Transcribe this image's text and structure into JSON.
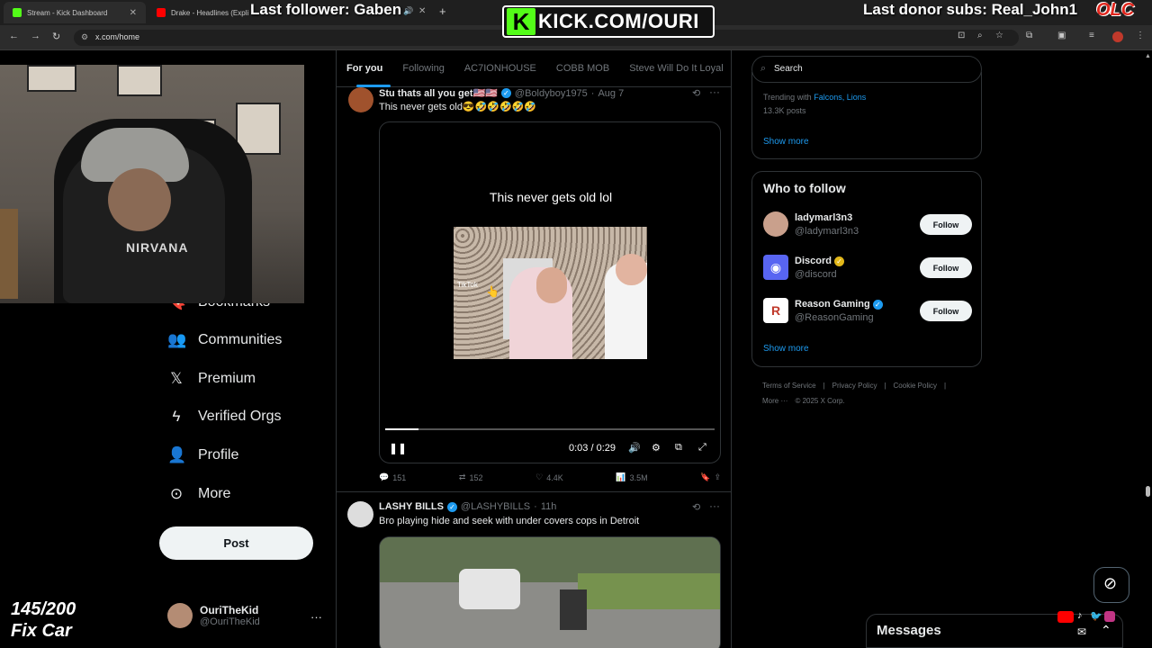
{
  "browser": {
    "tabs": [
      {
        "title": "Stream - Kick Dashboard",
        "favicon_color": "#53fc18"
      },
      {
        "title": "Drake - Headlines (Explicit)",
        "favicon_color": "#ff0000"
      }
    ],
    "url": "x.com/home"
  },
  "overlay": {
    "last_follower": "Last follower: Gaben",
    "kick_url": "KICK.COM/OURI",
    "last_donor": "Last donor subs: Real_John1",
    "brand": "OLC",
    "goal_count": "145/200",
    "goal_name": "Fix Car",
    "shirt_text": "NIRVANA"
  },
  "nav": {
    "items": [
      {
        "label": "Bookmarks",
        "icon": "bookmark-icon"
      },
      {
        "label": "Communities",
        "icon": "communities-icon"
      },
      {
        "label": "Premium",
        "icon": "x-logo-icon"
      },
      {
        "label": "Verified Orgs",
        "icon": "lightning-icon"
      },
      {
        "label": "Profile",
        "icon": "person-icon"
      },
      {
        "label": "More",
        "icon": "more-circle-icon"
      }
    ],
    "post_label": "Post",
    "account": {
      "name": "OuriTheKid",
      "handle": "@OuriTheKid"
    }
  },
  "feed": {
    "tabs": [
      "For you",
      "Following",
      "AC7IONHOUSE",
      "COBB MOB",
      "Steve Will Do It Loyal"
    ],
    "tweets": [
      {
        "name": "Stu thats all you get🇺🇸🇺🇸",
        "handle": "@Boldyboy1975",
        "time": "Aug 7",
        "text": "This never gets old😎🤣🤣🤣🤣🤣",
        "video_caption": "This never gets old lol",
        "video_watermark": "TikTok",
        "video_time": "0:03 / 0:29",
        "video_progress": 0.1,
        "stats": {
          "replies": "151",
          "reposts": "152",
          "likes": "4.4K",
          "views": "3.5M"
        }
      },
      {
        "name": "LASHY BILLS",
        "handle": "@LASHYBILLS",
        "time": "11h",
        "text": "Bro playing hide and seek with under covers cops in Detroit"
      }
    ]
  },
  "sidebar": {
    "search_placeholder": "Search",
    "trending": {
      "context": "Trending with",
      "topics": "Falcons, Lions",
      "count": "13.3K posts",
      "show_more": "Show more"
    },
    "who_to_follow": {
      "title": "Who to follow",
      "accounts": [
        {
          "name": "ladymarl3n3",
          "handle": "@ladymarl3n3",
          "avatar_color": "#c9a08c",
          "verified": false
        },
        {
          "name": "Discord",
          "handle": "@discord",
          "avatar_color": "#5865f2",
          "verified": "gold"
        },
        {
          "name": "Reason Gaming",
          "handle": "@ReasonGaming",
          "avatar_color": "#ffffff",
          "verified": "blue"
        }
      ],
      "follow_label": "Follow",
      "show_more": "Show more"
    },
    "footer": {
      "links": [
        "Terms of Service",
        "Privacy Policy",
        "Cookie Policy"
      ],
      "more": "More ···",
      "copyright": "© 2025 X Corp."
    }
  },
  "messages": {
    "title": "Messages"
  }
}
